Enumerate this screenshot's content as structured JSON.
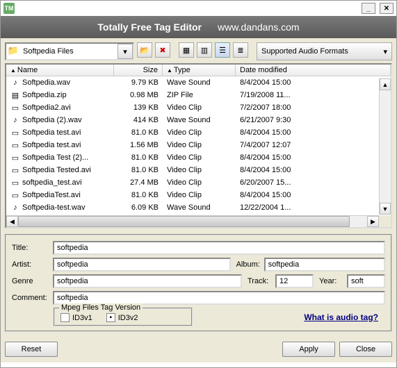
{
  "titlebar": {
    "icon": "TM"
  },
  "header": {
    "title": "Totally Free Tag Editor",
    "url": "www.dandans.com"
  },
  "toolbar": {
    "path": "Softpedia Files",
    "supported_label": "Supported Audio Formats"
  },
  "columns": {
    "name": "Name",
    "size": "Size",
    "type": "Type",
    "date": "Date modified"
  },
  "files": [
    {
      "icon": "♪",
      "name": "Softpedia.wav",
      "size": "9.79 KB",
      "type": "Wave Sound",
      "date": "8/4/2004 15:00"
    },
    {
      "icon": "▤",
      "name": "Softpedia.zip",
      "size": "0.98 MB",
      "type": "ZIP File",
      "date": "7/19/2008 11..."
    },
    {
      "icon": "▭",
      "name": "Softpedia2.avi",
      "size": "139 KB",
      "type": "Video Clip",
      "date": "7/2/2007 18:00"
    },
    {
      "icon": "♪",
      "name": "Softpedia (2).wav",
      "size": "414 KB",
      "type": "Wave Sound",
      "date": "6/21/2007 9:30"
    },
    {
      "icon": "▭",
      "name": "Softpedia test.avi",
      "size": "81.0 KB",
      "type": "Video Clip",
      "date": "8/4/2004 15:00"
    },
    {
      "icon": "▭",
      "name": "Softpedia test.avi",
      "size": "1.56 MB",
      "type": "Video Clip",
      "date": "7/4/2007 12:07"
    },
    {
      "icon": "▭",
      "name": "Softpedia Test (2)...",
      "size": "81.0 KB",
      "type": "Video Clip",
      "date": "8/4/2004 15:00"
    },
    {
      "icon": "▭",
      "name": "Softpedia Tested.avi",
      "size": "81.0 KB",
      "type": "Video Clip",
      "date": "8/4/2004 15:00"
    },
    {
      "icon": "▭",
      "name": "softpedia_test.avi",
      "size": "27.4 MB",
      "type": "Video Clip",
      "date": "6/20/2007 15..."
    },
    {
      "icon": "▭",
      "name": "SoftpediaTest.avi",
      "size": "81.0 KB",
      "type": "Video Clip",
      "date": "8/4/2004 15:00"
    },
    {
      "icon": "♪",
      "name": "Softpedia-test.wav",
      "size": "6.09 KB",
      "type": "Wave Sound",
      "date": "12/22/2004 1..."
    }
  ],
  "tags": {
    "title_lbl": "Title:",
    "title_val": "softpedia",
    "artist_lbl": "Artist:",
    "artist_val": "softpedia",
    "album_lbl": "Album:",
    "album_val": "softpedia",
    "genre_lbl": "Genre",
    "genre_val": "softpedia",
    "track_lbl": "Track:",
    "track_val": "12",
    "year_lbl": "Year:",
    "year_val": "soft",
    "comment_lbl": "Comment:",
    "comment_val": "softpedia",
    "mpeg_legend": "Mpeg Files Tag Version",
    "id3v1": "ID3v1",
    "id3v2": "ID3v2",
    "link": "What is audio tag?"
  },
  "buttons": {
    "reset": "Reset",
    "apply": "Apply",
    "close": "Close"
  }
}
